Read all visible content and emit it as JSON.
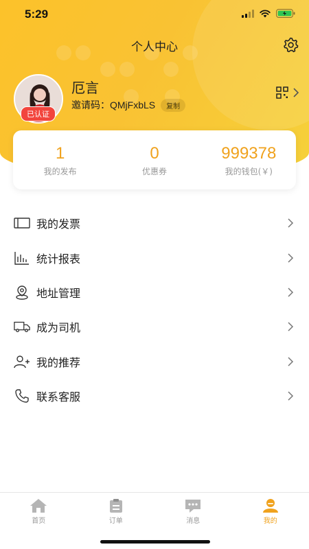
{
  "status": {
    "time": "5:29"
  },
  "header": {
    "title": "个人中心"
  },
  "profile": {
    "name": "厄言",
    "verified_label": "已认证",
    "invite_prefix": "邀请码：",
    "invite_code": "QMjFxbLS",
    "copy_label": "复制"
  },
  "stats": [
    {
      "value": "1",
      "label": "我的发布"
    },
    {
      "value": "0",
      "label": "优惠券"
    },
    {
      "value": "999378",
      "label": "我的钱包(￥)"
    }
  ],
  "menu": [
    {
      "label": "我的发票",
      "icon": "invoice-icon"
    },
    {
      "label": "统计报表",
      "icon": "chart-icon"
    },
    {
      "label": "地址管理",
      "icon": "location-icon"
    },
    {
      "label": "成为司机",
      "icon": "truck-icon"
    },
    {
      "label": "我的推荐",
      "icon": "add-user-icon"
    },
    {
      "label": "联系客服",
      "icon": "phone-icon"
    }
  ],
  "tabs": [
    {
      "label": "首页",
      "icon": "home-icon"
    },
    {
      "label": "订单",
      "icon": "clipboard-icon"
    },
    {
      "label": "消息",
      "icon": "message-icon"
    },
    {
      "label": "我的",
      "icon": "user-icon",
      "active": true
    }
  ],
  "colors": {
    "accent": "#f0a21d",
    "header": "#fcc22a",
    "badge": "#f2453d"
  }
}
